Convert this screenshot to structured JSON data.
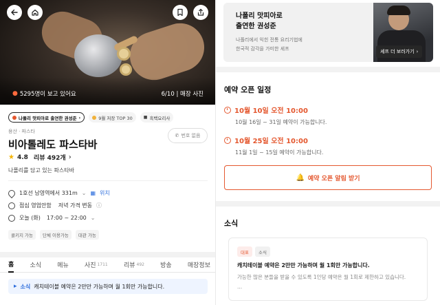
{
  "hero": {
    "viewers_text": "5295명이 보고 있어요",
    "photo_count": "6/10",
    "photo_label": "매장 사진"
  },
  "chips": [
    {
      "label": "나폴리 맛피아로 출연한 권성준",
      "dot_color": "#e4572e"
    },
    {
      "label": "9월 저장 TOP 30",
      "dot_color": "#f1b23b"
    },
    {
      "label": "흑백요리사"
    }
  ],
  "restaurant": {
    "category": "용산 · 파스타",
    "name": "비아톨레도 파스타바",
    "rating": "4.8",
    "reviews_label": "리뷰 492개",
    "tagline": "나폴리를 담고 있는 파스타바",
    "phone_label": "번호 없음"
  },
  "info": {
    "location": "1호선 남영역에서 331m",
    "location_link": "위치",
    "lunch": "점심 영업안함",
    "dinner_price": "저녁 가격 변동",
    "hours_prefix": "오늘 (화)",
    "hours": "17:00 ~ 22:00"
  },
  "tags": [
    "콜키지 가능",
    "단체 이용가능",
    "대관 가능"
  ],
  "tabs": [
    {
      "label": "홈",
      "count": ""
    },
    {
      "label": "소식",
      "count": ""
    },
    {
      "label": "메뉴",
      "count": ""
    },
    {
      "label": "사진",
      "count": "1711"
    },
    {
      "label": "리뷰",
      "count": "492"
    },
    {
      "label": "방송",
      "count": ""
    },
    {
      "label": "매장정보",
      "count": ""
    }
  ],
  "notice": {
    "label": "소식",
    "text": "캐치테이블 예약은 2만만 가능하며 월 1회만 가능합니다."
  },
  "chef": {
    "title_line1": "나폴리 맛피아로",
    "title_line2": "출연한 권성준",
    "sub_line1": "나폴리에서 익힌 전통 요리기법에",
    "sub_line2": "한국적 감각을 가미한 셰프",
    "link_label": "셰프 더 보러가기"
  },
  "reservation": {
    "title": "예약 오픈 일정",
    "openings": [
      {
        "time": "10월 10일 오전 10:00",
        "desc": "10월 16일 ~ 31일 예약이 가능합니다."
      },
      {
        "time": "10월 25일 오전 10:00",
        "desc": "11월 1일 ~ 15일 예약이 가능합니다."
      }
    ],
    "alarm_label": "예약 오픈 알림 받기"
  },
  "news": {
    "title": "소식",
    "badge_rep": "대표",
    "badge_news": "소식",
    "headline": "캐치테이블 예약은 2만만 가능하며 월 1회만 가능합니다.",
    "body": "가능한 많은 분들을 받을 수 있도록 1인당 예약은 월 1회로 제한하고 있습니다.",
    "more": "..."
  },
  "colors": {
    "accent": "#e4572e",
    "link": "#2f6fdd"
  }
}
